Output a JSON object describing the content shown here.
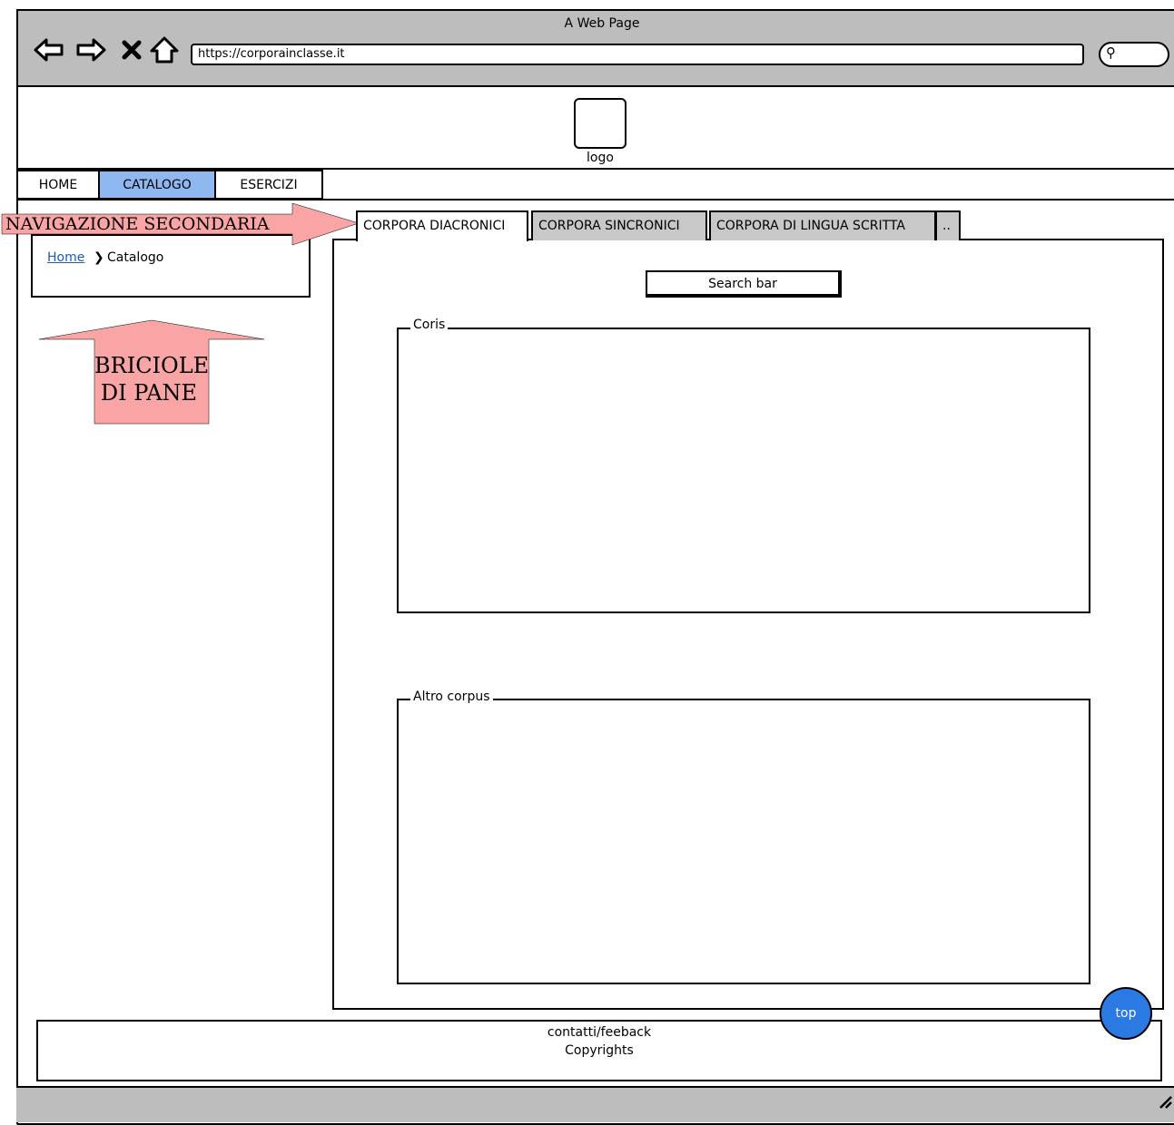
{
  "window": {
    "title": "A Web Page",
    "url": "https://corporainclasse.it"
  },
  "icons": [
    "back-icon",
    "forward-icon",
    "close-icon",
    "home-icon",
    "search-icon",
    "resize-icon"
  ],
  "header": {
    "logo_label": "logo"
  },
  "topnav": {
    "items": [
      {
        "label": "HOME"
      },
      {
        "label": "CATALOGO",
        "active": true
      },
      {
        "label": "ESERCIZI"
      }
    ],
    "active_color": "#8fb8f1"
  },
  "breadcrumb": {
    "home": "Home",
    "separator": "❯",
    "current": "Catalogo"
  },
  "subtabs": [
    {
      "label": "CORPORA DIACRONICI",
      "active": true
    },
    {
      "label": "CORPORA SINCRONICI"
    },
    {
      "label": "CORPORA DI LINGUA SCRITTA"
    },
    {
      "label": ".."
    }
  ],
  "search": {
    "label": "Search bar"
  },
  "sections": [
    {
      "legend": "Coris"
    },
    {
      "legend": "Altro corpus"
    }
  ],
  "footer": {
    "line1": "contatti/feeback",
    "line2": "Copyrights"
  },
  "top_button": {
    "label": "top",
    "color": "#2b7ae3"
  },
  "annotations": {
    "nav": "NAVIGAZIONE SECONDARIA",
    "breadcrumb_line1": "BRICIOLE",
    "breadcrumb_line2": "DI PANE",
    "color": "#f9a5a5"
  }
}
